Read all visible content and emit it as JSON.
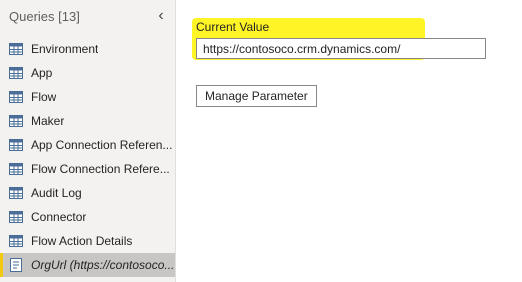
{
  "queries_pane": {
    "title": "Queries [13]",
    "collapse_icon": "chevron-left-icon",
    "items": [
      {
        "label": "Environment",
        "icon": "table-icon"
      },
      {
        "label": "App",
        "icon": "table-icon"
      },
      {
        "label": "Flow",
        "icon": "table-icon"
      },
      {
        "label": "Maker",
        "icon": "table-icon"
      },
      {
        "label": "App Connection Referen...",
        "icon": "table-icon"
      },
      {
        "label": "Flow Connection Refere...",
        "icon": "table-icon"
      },
      {
        "label": "Audit Log",
        "icon": "table-icon"
      },
      {
        "label": "Connector",
        "icon": "table-icon"
      },
      {
        "label": "Flow Action Details",
        "icon": "table-icon"
      },
      {
        "label": "OrgUrl (https://contosoco...",
        "icon": "parameter-icon",
        "selected": true
      }
    ]
  },
  "parameter": {
    "current_value_label": "Current Value",
    "current_value": "https://contosoco.crm.dynamics.com/",
    "manage_button_label": "Manage Parameter"
  },
  "colors": {
    "highlight": "#fff200",
    "selected_accent": "#f2c811"
  }
}
